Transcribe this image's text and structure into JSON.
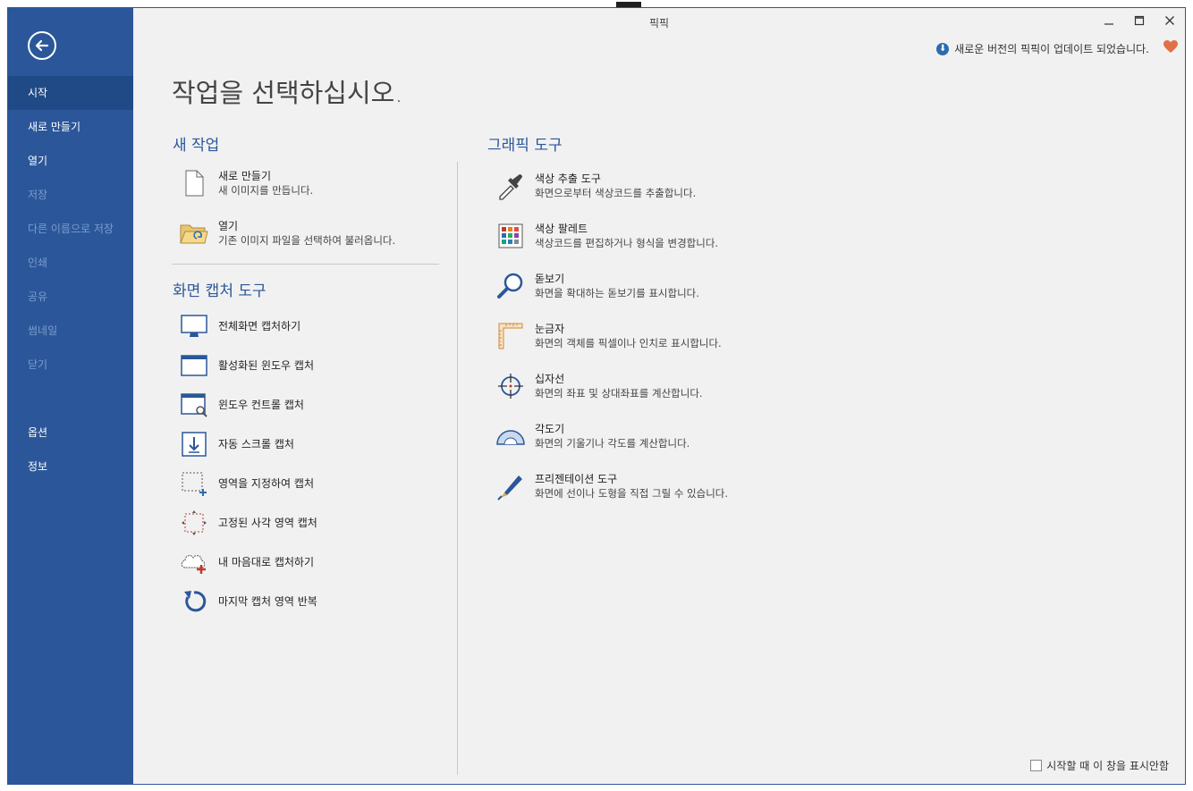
{
  "window": {
    "title": "픽픽"
  },
  "sidebar": {
    "items": [
      {
        "label": "시작",
        "state": "active"
      },
      {
        "label": "새로 만들기",
        "state": "normal"
      },
      {
        "label": "열기",
        "state": "normal"
      },
      {
        "label": "저장",
        "state": "disabled"
      },
      {
        "label": "다른 이름으로 저장",
        "state": "disabled"
      },
      {
        "label": "인쇄",
        "state": "disabled"
      },
      {
        "label": "공유",
        "state": "disabled"
      },
      {
        "label": "썸네일",
        "state": "disabled"
      },
      {
        "label": "닫기",
        "state": "disabled"
      }
    ],
    "bottom_items": [
      {
        "label": "옵션"
      },
      {
        "label": "정보"
      }
    ]
  },
  "notification": {
    "text": "새로운 버전의 픽픽이 업데이트 되었습니다."
  },
  "main": {
    "page_title": "작업을 선택하십시오.",
    "new_task": {
      "title": "새 작업",
      "items": [
        {
          "label": "새로 만들기",
          "desc": "새 이미지를 만듭니다.",
          "icon": "new-document-icon"
        },
        {
          "label": "열기",
          "desc": "기존 이미지 파일을 선택하여 불러옵니다.",
          "icon": "open-folder-icon"
        }
      ]
    },
    "capture": {
      "title": "화면 캡처 도구",
      "items": [
        {
          "label": "전체화면 캡처하기",
          "icon": "monitor-icon"
        },
        {
          "label": "활성화된 윈도우 캡처",
          "icon": "window-icon"
        },
        {
          "label": "윈도우 컨트롤 캡처",
          "icon": "window-control-icon"
        },
        {
          "label": "자동 스크롤 캡처",
          "icon": "scroll-capture-icon"
        },
        {
          "label": "영역을 지정하여 캡처",
          "icon": "region-select-icon"
        },
        {
          "label": "고정된 사각 영역 캡처",
          "icon": "fixed-region-icon"
        },
        {
          "label": "내 마음대로 캡처하기",
          "icon": "freehand-icon"
        },
        {
          "label": "마지막 캡처 영역 반복",
          "icon": "repeat-icon"
        }
      ]
    },
    "graphics": {
      "title": "그래픽 도구",
      "items": [
        {
          "label": "색상 추출 도구",
          "desc": "화면으로부터 색상코드를 추출합니다.",
          "icon": "eyedropper-icon"
        },
        {
          "label": "색상 팔레트",
          "desc": "색상코드를 편집하거나 형식을 변경합니다.",
          "icon": "palette-icon"
        },
        {
          "label": "돋보기",
          "desc": "화면을 확대하는 돋보기를 표시합니다.",
          "icon": "magnifier-icon"
        },
        {
          "label": "눈금자",
          "desc": "화면의 객체를 픽셀이나 인치로 표시합니다.",
          "icon": "ruler-icon"
        },
        {
          "label": "십자선",
          "desc": "화면의 좌표 및 상대좌표를 계산합니다.",
          "icon": "crosshair-icon"
        },
        {
          "label": "각도기",
          "desc": "화면의 기울기나 각도를 계산합니다.",
          "icon": "protractor-icon"
        },
        {
          "label": "프리젠테이션 도구",
          "desc": "화면에 선이나 도형을 직접 그릴 수 있습니다.",
          "icon": "pen-icon"
        }
      ]
    }
  },
  "footer": {
    "checkbox_label": "시작할 때 이 창을 표시안함",
    "checked": false
  },
  "colors": {
    "accent": "#2b579a",
    "heart": "#e0704a"
  }
}
